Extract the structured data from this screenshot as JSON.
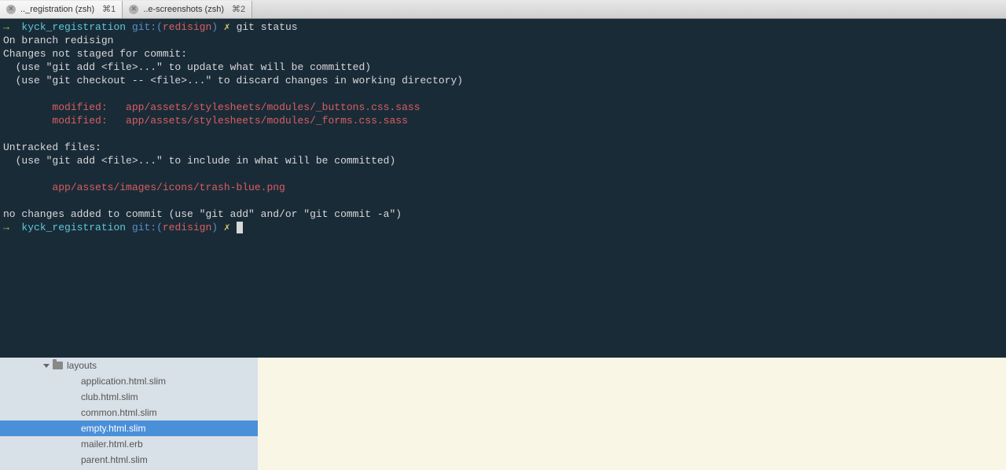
{
  "tabs": [
    {
      "label": ".._registration (zsh)",
      "shortcut": "⌘1"
    },
    {
      "label": "..e-screenshots (zsh)",
      "shortcut": "⌘2"
    }
  ],
  "terminal": {
    "prompt": {
      "arrow": "→",
      "dir": "kyck_registration",
      "git_label": "git:(",
      "branch": "redisign",
      "git_close": ")",
      "x": "✗"
    },
    "command1": "git status",
    "line_branch": "On branch redisign",
    "line_not_staged": "Changes not staged for commit:",
    "line_hint_add": "  (use \"git add <file>...\" to update what will be committed)",
    "line_hint_checkout": "  (use \"git checkout -- <file>...\" to discard changes in working directory)",
    "modified1_label": "        modified:   ",
    "modified1_file": "app/assets/stylesheets/modules/_buttons.css.sass",
    "modified2_label": "        modified:   ",
    "modified2_file": "app/assets/stylesheets/modules/_forms.css.sass",
    "line_untracked": "Untracked files:",
    "line_hint_include": "  (use \"git add <file>...\" to include in what will be committed)",
    "untracked1": "        app/assets/images/icons/trash-blue.png",
    "line_no_changes": "no changes added to commit (use \"git add\" and/or \"git commit -a\")"
  },
  "tree": {
    "folder": "layouts",
    "files": [
      "application.html.slim",
      "club.html.slim",
      "common.html.slim",
      "empty.html.slim",
      "mailer.html.erb",
      "parent.html.slim"
    ],
    "selected_index": 3
  }
}
